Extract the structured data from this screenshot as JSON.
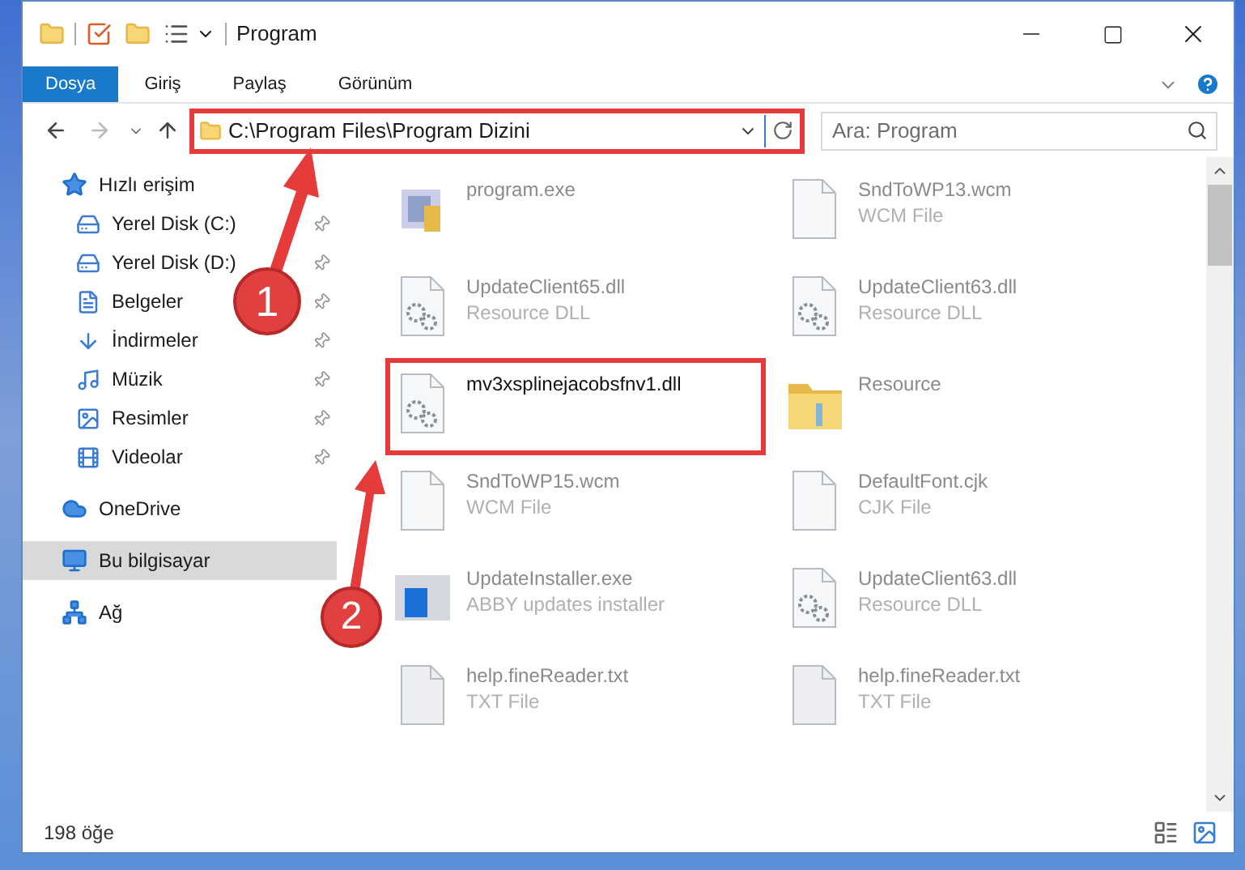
{
  "window": {
    "title": "Program"
  },
  "ribbon_tabs": [
    {
      "label": "Dosya",
      "selected": true
    },
    {
      "label": "Giriş",
      "selected": false
    },
    {
      "label": "Paylaş",
      "selected": false
    },
    {
      "label": "Görünüm",
      "selected": false
    }
  ],
  "address_bar": {
    "path": "C:\\Program Files\\Program Dizini",
    "annotated": true
  },
  "search": {
    "placeholder": "Ara: Program"
  },
  "sidebar": {
    "items": [
      {
        "label": "Hızlı erişim",
        "selected": false,
        "children": [
          {
            "label": "Yerel Disk (C:)",
            "pinned": true
          },
          {
            "label": "Yerel Disk (D:)",
            "pinned": true
          },
          {
            "label": "Belgeler",
            "pinned": true
          },
          {
            "label": "İndirmeler",
            "pinned": true
          },
          {
            "label": "Müzik",
            "pinned": true
          },
          {
            "label": "Resimler",
            "pinned": true
          },
          {
            "label": "Videolar",
            "pinned": true
          }
        ]
      },
      {
        "label": "OneDrive",
        "selected": false
      },
      {
        "label": "Bu bilgisayar",
        "selected": true
      },
      {
        "label": "Ağ",
        "selected": false
      }
    ]
  },
  "files": [
    {
      "name": "program.exe",
      "kind": "exe",
      "annotated": false
    },
    {
      "name": "SndToWP13.wcm",
      "type": "WCM File",
      "kind": "document",
      "annotated": false
    },
    {
      "name": "UpdateClient65.dll",
      "type": "Resource DLL",
      "kind": "dll",
      "annotated": false
    },
    {
      "name": "UpdateClient63.dll",
      "type": "Resource DLL",
      "kind": "dll",
      "annotated": false
    },
    {
      "name": "mv3xsplinejacobsfnv1.dll",
      "kind": "dll",
      "annotated": true
    },
    {
      "name": "Resource",
      "kind": "folder",
      "annotated": false
    },
    {
      "name": "SndToWP15.wcm",
      "type": "WCM File",
      "kind": "document",
      "annotated": false
    },
    {
      "name": "DefaultFont.cjk",
      "type": "CJK File",
      "kind": "document",
      "annotated": false
    },
    {
      "name": "UpdateInstaller.exe",
      "type": "ABBY updates installer",
      "kind": "installer",
      "annotated": false
    },
    {
      "name": "UpdateClient63.dll",
      "type": "Resource DLL",
      "kind": "dll",
      "annotated": false
    },
    {
      "name": "help.fineReader.txt",
      "type": "TXT File",
      "kind": "text",
      "annotated": false
    },
    {
      "name": "help.fineReader.txt",
      "type": "TXT File",
      "kind": "text",
      "annotated": false
    }
  ],
  "status_bar": {
    "item_count": "198 öğe"
  },
  "callouts": [
    {
      "label": "1"
    },
    {
      "label": "2"
    }
  ]
}
